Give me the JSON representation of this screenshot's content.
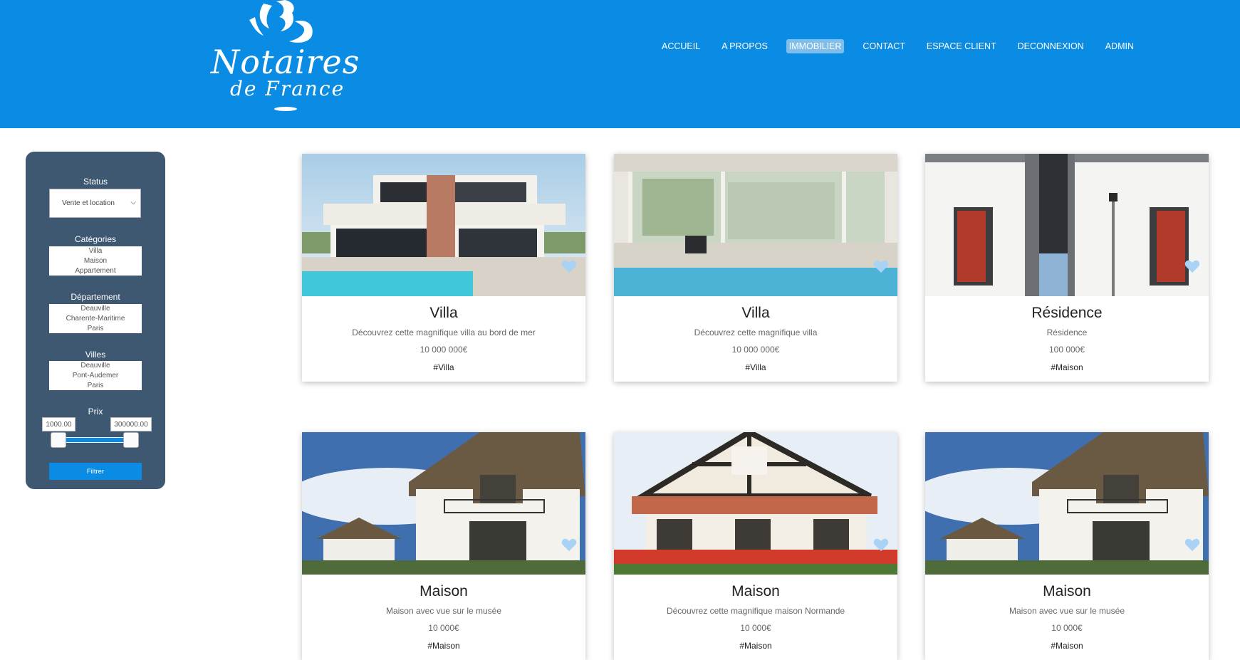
{
  "header": {
    "logo_line1": "Notaires",
    "logo_line2": "de France",
    "nav": [
      "ACCUEIL",
      "A PROPOS",
      "IMMOBILIER",
      "CONTACT",
      "ESPACE CLIENT",
      "DECONNEXION",
      "ADMIN"
    ],
    "active_nav": "IMMOBILIER"
  },
  "filters": {
    "status_label": "Status",
    "status_value": "Vente et location",
    "categories_label": "Catégories",
    "categories": [
      "Villa",
      "Maison",
      "Appartement"
    ],
    "departement_label": "Département",
    "departements": [
      "Deauville",
      "Charente-Maritime",
      "Paris"
    ],
    "villes_label": "Villes",
    "villes": [
      "Deauville",
      "Pont-Audemer",
      "Paris"
    ],
    "prix_label": "Prix",
    "prix_min": "1000.00",
    "prix_max": "300000.00",
    "filter_button": "Filtrer"
  },
  "listings": [
    {
      "title": "Villa",
      "description": "Découvrez cette magnifique villa au bord de mer",
      "price": "10 000 000€",
      "tag": "#Villa",
      "image": "modern-villa-pool"
    },
    {
      "title": "Villa",
      "description": "Découvrez cette magnifique villa",
      "price": "10 000 000€",
      "tag": "#Villa",
      "image": "glass-villa-pool"
    },
    {
      "title": "Résidence",
      "description": "Résidence",
      "price": "100 000€",
      "tag": "#Maison",
      "image": "residence-facade"
    },
    {
      "title": "Maison",
      "description": "Maison avec vue sur le musée",
      "price": "10 000€",
      "tag": "#Maison",
      "image": "thatched-house"
    },
    {
      "title": "Maison",
      "description": "Découvrez cette magnifique maison Normande",
      "price": "10 000€",
      "tag": "#Maison",
      "image": "half-timbered-house"
    },
    {
      "title": "Maison",
      "description": "Maison avec vue sur le musée",
      "price": "10 000€",
      "tag": "#Maison",
      "image": "thatched-house"
    }
  ],
  "colors": {
    "header_bg": "#0a8ce4",
    "sidebar_bg": "#3e5872",
    "heart": "#a9d3f5"
  }
}
